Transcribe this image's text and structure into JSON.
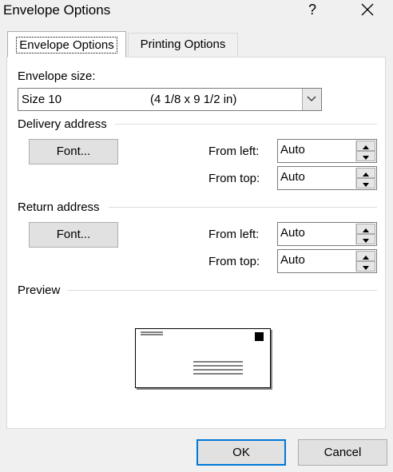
{
  "window": {
    "title": "Envelope Options",
    "help": "?"
  },
  "tabs": [
    {
      "label": "Envelope Options",
      "active": true
    },
    {
      "label": "Printing Options",
      "active": false
    }
  ],
  "envelope_size": {
    "label": "Envelope size:",
    "selected_name": "Size 10",
    "selected_dims": "(4 1/8 x 9 1/2 in)"
  },
  "delivery": {
    "heading": "Delivery address",
    "font_button": "Font...",
    "from_left_label": "From left:",
    "from_left_value": "Auto",
    "from_top_label": "From top:",
    "from_top_value": "Auto"
  },
  "return": {
    "heading": "Return address",
    "font_button": "Font...",
    "from_left_label": "From left:",
    "from_left_value": "Auto",
    "from_top_label": "From top:",
    "from_top_value": "Auto"
  },
  "preview": {
    "heading": "Preview"
  },
  "buttons": {
    "ok": "OK",
    "cancel": "Cancel"
  }
}
